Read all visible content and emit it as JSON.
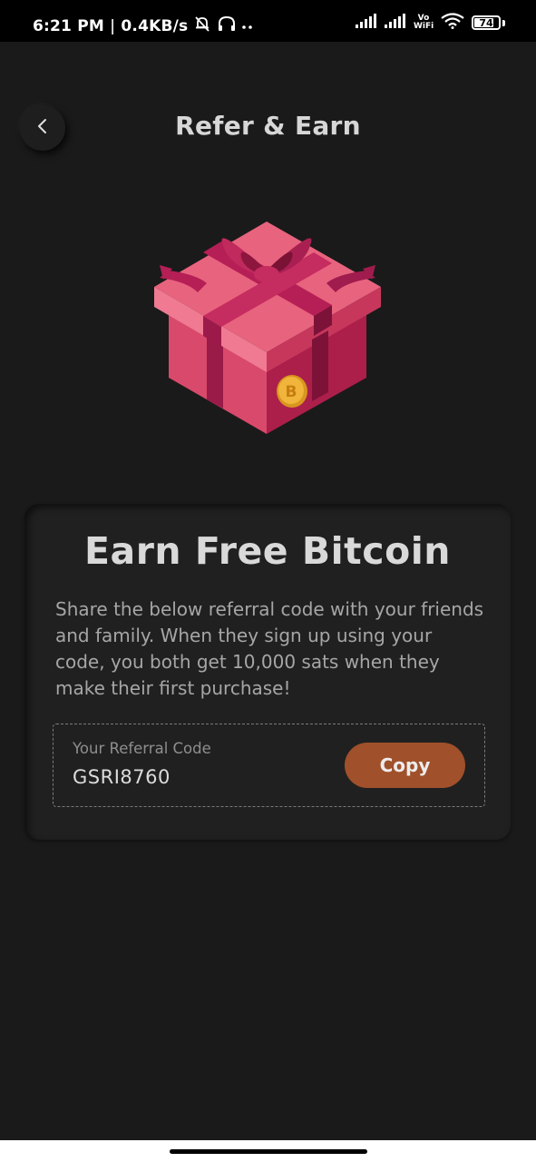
{
  "status_bar": {
    "time": "6:21 PM",
    "separator": "|",
    "network_speed": "0.4KB/s",
    "icons_left": [
      "bell-muted-icon",
      "headphones-icon",
      "more-dots-icon"
    ],
    "icons_right": [
      "signal-icon",
      "signal-icon",
      "vowifi-icon",
      "wifi-icon",
      "battery-icon"
    ],
    "vowifi_top": "Vo",
    "vowifi_bottom": "WiFi",
    "battery_level": "74"
  },
  "header": {
    "back_icon": "chevron-left-icon",
    "title": "Refer & Earn"
  },
  "illustration": {
    "name": "gift-box-illustration",
    "coin_icon": "bitcoin-icon",
    "colors": {
      "box_top": "#e8637e",
      "box_left": "#d9496b",
      "box_right": "#ac1f4a",
      "ribbon": "#b51f56",
      "coin": "#f0b53a"
    }
  },
  "card": {
    "title": "Earn Free Bitcoin",
    "description": "Share the below referral code with your friends and family. When they sign up using your code, you both get 10,000 sats when they make their first purchase!",
    "code_label": "Your Referral Code",
    "code_value": "GSRI8760",
    "copy_label": "Copy"
  },
  "colors": {
    "background": "#1a1a1a",
    "card": "#202020",
    "accent": "#a0502a"
  }
}
